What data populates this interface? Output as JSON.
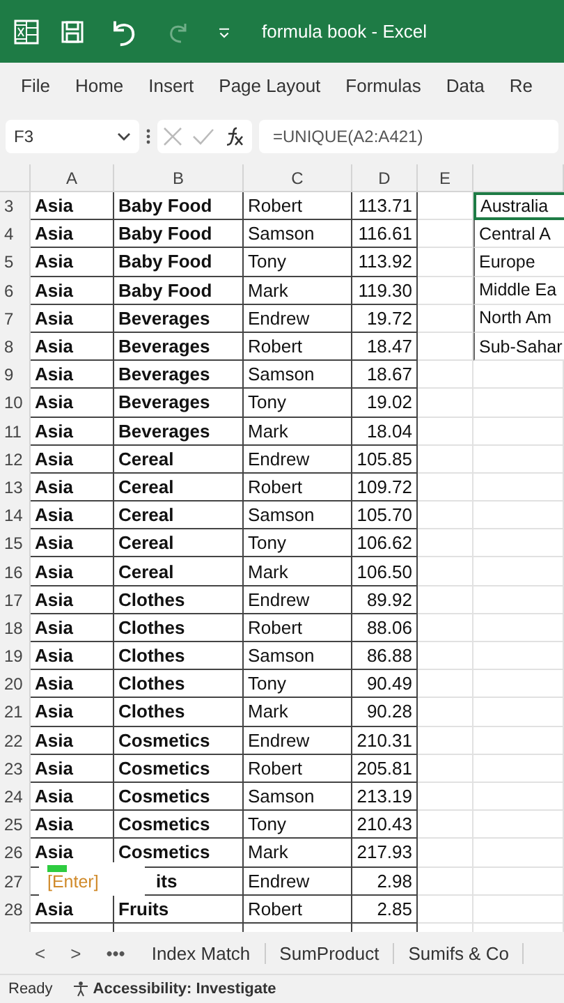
{
  "title_bar": {
    "title": "formula book  -  Excel"
  },
  "ribbon_tabs": [
    "File",
    "Home",
    "Insert",
    "Page Layout",
    "Formulas",
    "Data",
    "Re"
  ],
  "formula_bar": {
    "name_box": "F3",
    "formula": "=UNIQUE(A2:A421)"
  },
  "columns": [
    "A",
    "B",
    "C",
    "D",
    "E"
  ],
  "rows": [
    {
      "num": "3",
      "a": "Asia",
      "b": "Baby Food",
      "c": "Robert",
      "d": "113.71",
      "f": "Australia",
      "f_selected": true
    },
    {
      "num": "4",
      "a": "Asia",
      "b": "Baby Food",
      "c": "Samson",
      "d": "116.61",
      "f": "Central A",
      "f_selected": false
    },
    {
      "num": "5",
      "a": "Asia",
      "b": "Baby Food",
      "c": "Tony",
      "d": "113.92",
      "f": "Europe",
      "f_selected": false
    },
    {
      "num": "6",
      "a": "Asia",
      "b": "Baby Food",
      "c": "Mark",
      "d": "119.30",
      "f": "Middle Ea",
      "f_selected": false
    },
    {
      "num": "7",
      "a": "Asia",
      "b": "Beverages",
      "c": "Endrew",
      "d": "19.72",
      "f": "North Am",
      "f_selected": false
    },
    {
      "num": "8",
      "a": "Asia",
      "b": "Beverages",
      "c": "Robert",
      "d": "18.47",
      "f": "Sub-Sahar",
      "f_selected": false
    },
    {
      "num": "9",
      "a": "Asia",
      "b": "Beverages",
      "c": "Samson",
      "d": "18.67"
    },
    {
      "num": "10",
      "a": "Asia",
      "b": "Beverages",
      "c": "Tony",
      "d": "19.02"
    },
    {
      "num": "11",
      "a": "Asia",
      "b": "Beverages",
      "c": "Mark",
      "d": "18.04"
    },
    {
      "num": "12",
      "a": "Asia",
      "b": "Cereal",
      "c": "Endrew",
      "d": "105.85"
    },
    {
      "num": "13",
      "a": "Asia",
      "b": "Cereal",
      "c": "Robert",
      "d": "109.72"
    },
    {
      "num": "14",
      "a": "Asia",
      "b": "Cereal",
      "c": "Samson",
      "d": "105.70"
    },
    {
      "num": "15",
      "a": "Asia",
      "b": "Cereal",
      "c": "Tony",
      "d": "106.62"
    },
    {
      "num": "16",
      "a": "Asia",
      "b": "Cereal",
      "c": "Mark",
      "d": "106.50"
    },
    {
      "num": "17",
      "a": "Asia",
      "b": "Clothes",
      "c": "Endrew",
      "d": "89.92"
    },
    {
      "num": "18",
      "a": "Asia",
      "b": "Clothes",
      "c": "Robert",
      "d": "88.06"
    },
    {
      "num": "19",
      "a": "Asia",
      "b": "Clothes",
      "c": "Samson",
      "d": "86.88"
    },
    {
      "num": "20",
      "a": "Asia",
      "b": "Clothes",
      "c": "Tony",
      "d": "90.49"
    },
    {
      "num": "21",
      "a": "Asia",
      "b": "Clothes",
      "c": "Mark",
      "d": "90.28"
    },
    {
      "num": "22",
      "a": "Asia",
      "b": "Cosmetics",
      "c": "Endrew",
      "d": "210.31"
    },
    {
      "num": "23",
      "a": "Asia",
      "b": "Cosmetics",
      "c": "Robert",
      "d": "205.81"
    },
    {
      "num": "24",
      "a": "Asia",
      "b": "Cosmetics",
      "c": "Samson",
      "d": "213.19"
    },
    {
      "num": "25",
      "a": "Asia",
      "b": "Cosmetics",
      "c": "Tony",
      "d": "210.43"
    },
    {
      "num": "26",
      "a": "Asia",
      "b": "Cosmetics",
      "c": "Mark",
      "d": "217.93"
    },
    {
      "num": "27",
      "b": "its",
      "c": "Endrew",
      "d": "2.98",
      "keytip": "[Enter]"
    },
    {
      "num": "28",
      "a": "Asia",
      "b": "Fruits",
      "c": "Robert",
      "d": "2.85"
    }
  ],
  "sheet_tabs": {
    "nav": [
      "<",
      ">",
      "•••"
    ],
    "tabs": [
      "Index Match",
      "SumProduct",
      "Sumifs & Co"
    ]
  },
  "status_bar": {
    "state": "Ready",
    "accessibility": "Accessibility: Investigate"
  }
}
